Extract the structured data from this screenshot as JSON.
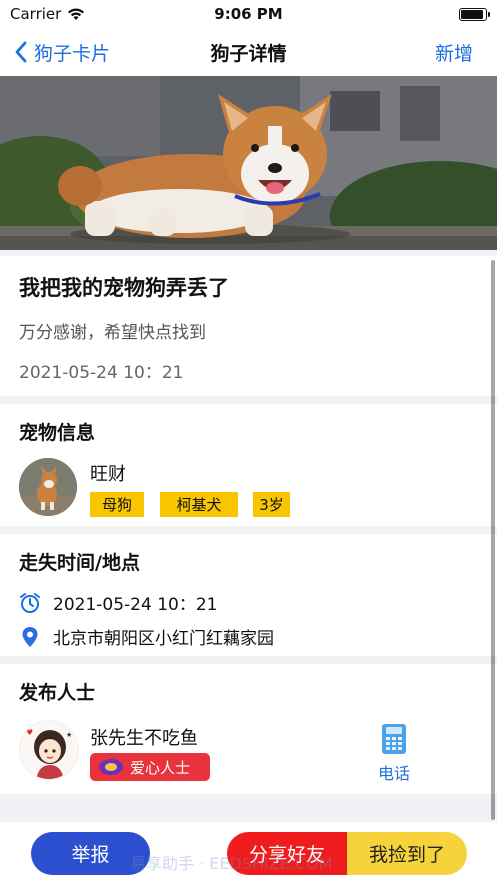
{
  "status_bar": {
    "carrier": "Carrier",
    "time": "9:06 PM"
  },
  "nav": {
    "back_label": "狗子卡片",
    "title": "狗子详情",
    "right_label": "新增"
  },
  "post": {
    "title": "我把我的宠物狗弄丢了",
    "subtitle": "万分感谢，希望快点找到",
    "datetime": "2021-05-24 10：21"
  },
  "pet_info": {
    "section_title": "宠物信息",
    "name": "旺财",
    "tags": [
      "母狗",
      "柯基犬",
      "3岁"
    ]
  },
  "lost": {
    "section_title": "走失时间/地点",
    "time": "2021-05-24 10：21",
    "location": "北京市朝阳区小红门红藕家园"
  },
  "poster": {
    "section_title": "发布人士",
    "name": "张先生不吃鱼",
    "badge": "爱心人士",
    "phone_label": "电话"
  },
  "actions": {
    "report": "举报",
    "share": "分享好友",
    "found": "我捡到了"
  },
  "watermark": "易享助手 · EEDSHIZE.COM",
  "colors": {
    "accent": "#1a6fe0",
    "tag_bg": "#f7c600",
    "badge_bg": "#e8333c",
    "report": "#2c50d0",
    "share": "#ee1c1c",
    "found": "#f6d33a"
  },
  "icons": {
    "back": "chevron-left-icon",
    "wifi": "wifi-icon",
    "battery": "battery-icon",
    "alarm": "alarm-clock-icon",
    "location": "location-pin-icon",
    "phone": "telephone-icon"
  }
}
